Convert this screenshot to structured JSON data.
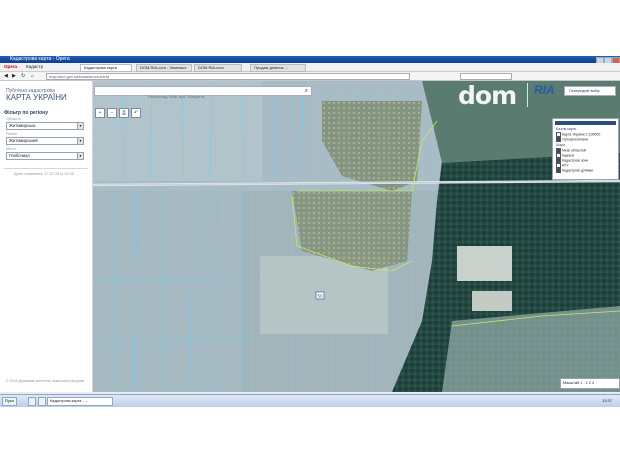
{
  "browser": {
    "title": "Кадастрова карта - Opera",
    "menu": [
      "Opera",
      "Кадастр"
    ],
    "tabs": [
      "Кадастрова карта",
      "DOM.RIA.com - Земельні",
      "DOM.RIA.com",
      "Продаж ділянок ..."
    ],
    "address": "map.land.gov.ua/kadastrova-karta"
  },
  "sidebar": {
    "brand_line1": "Публічна кадастрова",
    "brand_line2": "КАРТА УКРАЇНИ",
    "filter_title": "Фільтр по регіону",
    "fields": [
      {
        "label": "Область",
        "value": "Житомирська"
      },
      {
        "label": "Район",
        "value": "Житомирський"
      },
      {
        "label": "Місто",
        "value": "Глибочиця"
      }
    ],
    "date_info": "Дата оновлення: 17.07.2014 04:00",
    "copyright": "© 2014 Державне агентство земельних ресурсів"
  },
  "map": {
    "search_placeholder": "",
    "search_hint": "Наприклад: Київ, вул. Хрещатик",
    "tools": [
      "+",
      "−",
      "⎙",
      "↶"
    ],
    "plot_marker": "50",
    "prev_button": "Попередній вибір",
    "layers_title": "Шари",
    "layers": [
      {
        "label": "Базові карти",
        "checked": false,
        "header": true
      },
      {
        "label": "Карта України 1:100000",
        "checked": false
      },
      {
        "label": "Ортофотоплани",
        "checked": true
      },
      {
        "label": "Шари",
        "checked": false,
        "header": true
      },
      {
        "label": "Межі областей",
        "checked": true
      },
      {
        "label": "Індекси",
        "checked": false
      },
      {
        "label": "Кадастрові зони",
        "checked": true
      },
      {
        "label": "АТУ",
        "checked": false
      },
      {
        "label": "Кадастрові ділянки",
        "checked": true
      }
    ],
    "scale_text": "Масштаб 1 : 1 2 4"
  },
  "watermark": {
    "dom": "dom",
    "ria": "RIA"
  },
  "taskbar": {
    "start": "Пуск",
    "buttons": [
      "Кадастрова карта - ..."
    ],
    "clock": "13:37"
  },
  "colors": {
    "accent": "#2c4d82",
    "parcel_lines": "#5fd0ff",
    "zone_lines": "#c9e86a"
  }
}
